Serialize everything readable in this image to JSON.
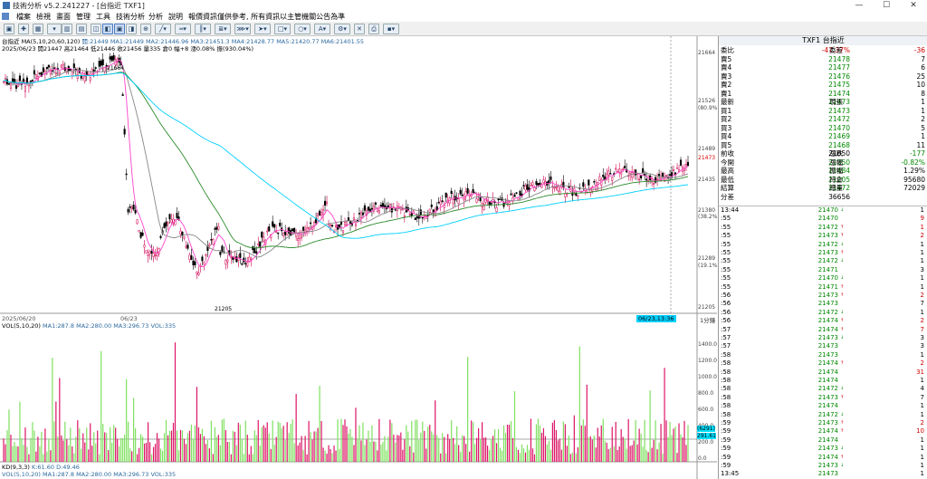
{
  "window": {
    "title": "技術分析 v5.2.241227 - [台指近 TXF1]",
    "minimize": "—",
    "maximize": "☐",
    "close": "✕"
  },
  "menu": [
    "檔案",
    "檢視",
    "畫面",
    "管理",
    "工具",
    "技術分析",
    "分析",
    "說明",
    "報價資訊僅供參考, 所有資訊以主管機關公告為準"
  ],
  "chart_info": {
    "line1_ma": "台指近 MA(5,10,20,60,120)",
    "line1_rest": "開:21449  MA1:21449  MA2:21446.96  MA3:21451.3  MA4:21428.77  MA5:21420.77  MA6:21401.55",
    "line2": "2025/06/23  開21447  高21464  低21446  收21456  量335  倉0  幅+8  漲0.08%  振(930.04%)",
    "vol_label": "VOL(5,10,20)",
    "vol_values": "MA1:287.8  MA2:280.00  MA3:296.73  VOL:335",
    "kd_label": "KD(9,3,3)",
    "kd_values": "K:61.60  D:49.46",
    "bottom_vol": "VOL(5,10,20) MA1:287.8 MA2:280.00 MA3:296.73 VOL:335",
    "date_left": "2025/06/20",
    "date_mid": "06/23",
    "cursor_time": "06/23,13:36",
    "period": "1分鐘"
  },
  "chart_annotations": {
    "high": "21664",
    "low": "21205"
  },
  "price_axis": [
    "21664",
    "21526",
    "(80.9%)",
    "21489",
    "21473",
    "21435",
    "21380",
    "(38.2%)",
    "21289",
    "(19.1%)",
    "21205"
  ],
  "vol_axis": [
    "1400.0",
    "1200.0",
    "1000.0",
    "800.0",
    "600.0",
    "400.0",
    "200.0",
    "0.0"
  ],
  "vol_badges": [
    "(6291)",
    "291.61"
  ],
  "quote": {
    "title": "TXF1 台指近",
    "rows": [
      {
        "l": "委比",
        "p": "-47.37%",
        "l2": "委差",
        "v": "-36",
        "pc": "red",
        "vc": "red"
      },
      {
        "l": "賣5",
        "p": "21478",
        "v": "7",
        "pc": "green",
        "vc": ""
      },
      {
        "l": "賣4",
        "p": "21477",
        "v": "6",
        "pc": "green",
        "vc": ""
      },
      {
        "l": "賣3",
        "p": "21476",
        "v": "25",
        "pc": "green",
        "vc": ""
      },
      {
        "l": "賣2",
        "p": "21475",
        "v": "10",
        "pc": "green",
        "vc": ""
      },
      {
        "l": "賣1",
        "p": "21474",
        "v": "8",
        "pc": "green",
        "vc": ""
      },
      {
        "l": "最新",
        "p": "21473",
        "l2": "現張",
        "v": "1",
        "pc": "green",
        "vc": ""
      },
      {
        "l": "買1",
        "p": "21473",
        "v": "1",
        "pc": "green",
        "vc": ""
      },
      {
        "l": "買2",
        "p": "21472",
        "v": "2",
        "pc": "green",
        "vc": ""
      },
      {
        "l": "買3",
        "p": "21470",
        "v": "5",
        "pc": "green",
        "vc": ""
      },
      {
        "l": "買4",
        "p": "21469",
        "v": "1",
        "pc": "green",
        "vc": ""
      },
      {
        "l": "買5",
        "p": "21468",
        "v": "11",
        "pc": "green",
        "vc": ""
      },
      {
        "l": "前收",
        "p": "21650",
        "l2": "漲跌",
        "v": "-177",
        "pc": "",
        "vc": "green"
      },
      {
        "l": "今開",
        "p": "21350",
        "l2": "漲幅",
        "v": "-0.82%",
        "pc": "green",
        "vc": "green"
      },
      {
        "l": "最高",
        "p": "21484",
        "l2": "振幅",
        "v": "1.29%",
        "pc": "green",
        "vc": ""
      },
      {
        "l": "最低",
        "p": "21205",
        "l2": "持倉",
        "v": "95680",
        "pc": "green",
        "vc": ""
      },
      {
        "l": "結算",
        "p": "21472",
        "l2": "總量",
        "v": "72029",
        "pc": "green",
        "vc": ""
      },
      {
        "l": "分差",
        "p": "36656",
        "v": "",
        "pc": "",
        "vc": ""
      }
    ]
  },
  "ticks": [
    {
      "t": "13:44",
      "p": "21470",
      "a": "↓",
      "q": "1",
      "qc": ""
    },
    {
      "t": ":55",
      "p": "21470",
      "a": "",
      "q": "9",
      "qc": "red"
    },
    {
      "t": ":55",
      "p": "21472",
      "a": "↑",
      "q": "1",
      "qc": "red"
    },
    {
      "t": ":55",
      "p": "21473",
      "a": "↑",
      "q": "2",
      "qc": "red"
    },
    {
      "t": ":55",
      "p": "21472",
      "a": "↓",
      "q": "1",
      "qc": ""
    },
    {
      "t": ":55",
      "p": "21473",
      "a": "↑",
      "q": "1",
      "qc": ""
    },
    {
      "t": ":55",
      "p": "21472",
      "a": "↓",
      "q": "1",
      "qc": ""
    },
    {
      "t": ":55",
      "p": "21471",
      "a": "",
      "q": "3",
      "qc": ""
    },
    {
      "t": ":55",
      "p": "21470",
      "a": "↓",
      "q": "1",
      "qc": ""
    },
    {
      "t": ":55",
      "p": "21471",
      "a": "↑",
      "q": "1",
      "qc": ""
    },
    {
      "t": ":56",
      "p": "21473",
      "a": "↑",
      "q": "2",
      "qc": "red"
    },
    {
      "t": ":56",
      "p": "21473",
      "a": "",
      "q": "7",
      "qc": ""
    },
    {
      "t": ":56",
      "p": "21472",
      "a": "↓",
      "q": "1",
      "qc": ""
    },
    {
      "t": ":56",
      "p": "21474",
      "a": "↑",
      "q": "2",
      "qc": "red"
    },
    {
      "t": ":57",
      "p": "21474",
      "a": "↑",
      "q": "7",
      "qc": "red"
    },
    {
      "t": ":57",
      "p": "21473",
      "a": "↓",
      "q": "3",
      "qc": ""
    },
    {
      "t": ":57",
      "p": "21473",
      "a": "",
      "q": "3",
      "qc": ""
    },
    {
      "t": ":58",
      "p": "21473",
      "a": "",
      "q": "1",
      "qc": ""
    },
    {
      "t": ":58",
      "p": "21474",
      "a": "↑",
      "q": "2",
      "qc": "red"
    },
    {
      "t": ":58",
      "p": "21474",
      "a": "",
      "q": "31",
      "qc": "red"
    },
    {
      "t": ":58",
      "p": "21474",
      "a": "",
      "q": "1",
      "qc": ""
    },
    {
      "t": ":58",
      "p": "21472",
      "a": "↓",
      "q": "4",
      "qc": ""
    },
    {
      "t": ":58",
      "p": "21473",
      "a": "↑",
      "q": "7",
      "qc": ""
    },
    {
      "t": ":58",
      "p": "21474",
      "a": "",
      "q": "1",
      "qc": ""
    },
    {
      "t": ":58",
      "p": "21472",
      "a": "↓",
      "q": "1",
      "qc": ""
    },
    {
      "t": ":59",
      "p": "21473",
      "a": "↑",
      "q": "2",
      "qc": "red"
    },
    {
      "t": ":59",
      "p": "21474",
      "a": "↑",
      "q": "10",
      "qc": "red"
    },
    {
      "t": ":59",
      "p": "21474",
      "a": "",
      "q": "1",
      "qc": ""
    },
    {
      "t": ":59",
      "p": "21473",
      "a": "↓",
      "q": "1",
      "qc": ""
    },
    {
      "t": ":59",
      "p": "21474",
      "a": "↑",
      "q": "1",
      "qc": ""
    },
    {
      "t": ":59",
      "p": "21473",
      "a": "↓",
      "q": "1",
      "qc": ""
    },
    {
      "t": "13:45",
      "p": "21473",
      "a": "",
      "q": "1",
      "qc": ""
    }
  ],
  "colors": {
    "up": "#d00050",
    "down": "#000000",
    "vol_up": "#dc1466",
    "vol_down": "#7fe060",
    "ma_cyan": "#00d0ff",
    "ma_green": "#2a8a2a",
    "ma_pink": "#ff44cc",
    "ma_gray": "#888888",
    "red": "#d00000",
    "green": "#008800"
  }
}
